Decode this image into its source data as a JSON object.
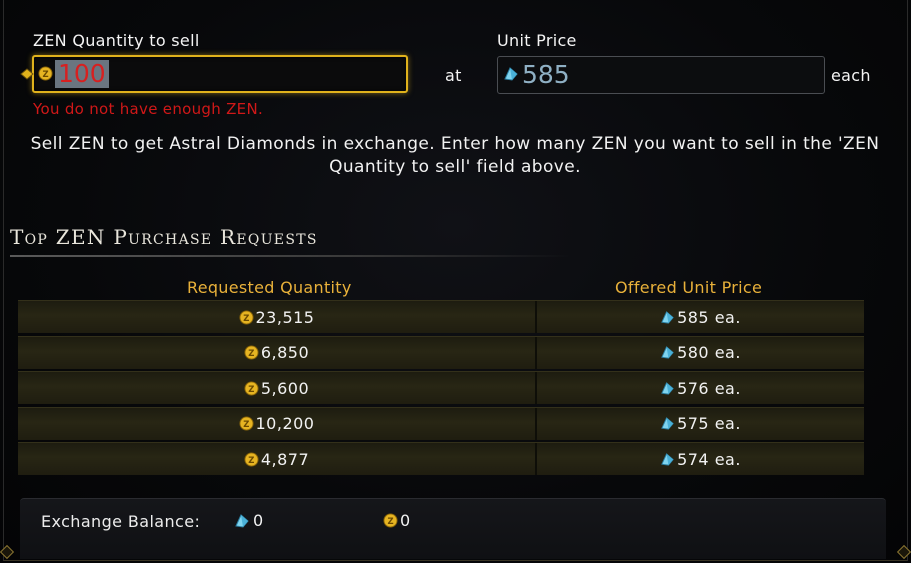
{
  "form": {
    "zen_qty_label": "ZEN Quantity to sell",
    "zen_qty_value": "100",
    "error": "You do not have enough ZEN.",
    "at_label": "at",
    "unit_price_label": "Unit Price",
    "unit_price_value": "585",
    "each_label": "each"
  },
  "description": "Sell ZEN to get Astral Diamonds in exchange. Enter how many ZEN you want to sell in the 'ZEN Quantity to sell' field above.",
  "requests": {
    "title": "Top ZEN Purchase Requests",
    "col_qty": "Requested Quantity",
    "col_price": "Offered Unit Price",
    "rows": [
      {
        "qty": "23,515",
        "price": "585 ea."
      },
      {
        "qty": "6,850",
        "price": "580 ea."
      },
      {
        "qty": "5,600",
        "price": "576 ea."
      },
      {
        "qty": "10,200",
        "price": "575 ea."
      },
      {
        "qty": "4,877",
        "price": "574 ea."
      }
    ]
  },
  "balance": {
    "label": "Exchange Balance:",
    "astral_diamonds": "0",
    "zen": "0"
  },
  "icons": {
    "zen": "zen-coin-icon",
    "astral_diamond": "astral-diamond-icon"
  },
  "colors": {
    "accent_gold": "#e0b21c",
    "header_gold": "#e9b13a",
    "error_red": "#d01818",
    "price_blue": "#8fb0c4"
  }
}
